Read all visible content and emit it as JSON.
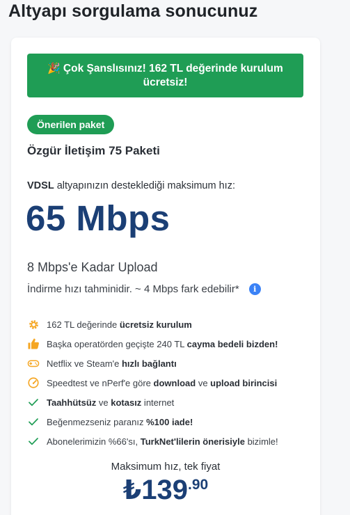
{
  "page": {
    "title": "Altyapı sorgulama sonucunuz"
  },
  "promo": {
    "icon": "party-popper-icon",
    "text": "Çok Şanslısınız! 162 TL değerinde kurulum ücretsiz!",
    "bg_color": "#1f9d55"
  },
  "package": {
    "badge": "Önerilen paket",
    "name": "Özgür İletişim 75 Paketi",
    "infra_type": "VDSL",
    "infra_text": " altyapınızın desteklediği maksimum hız:",
    "speed": "65 Mbps",
    "upload": "8 Mbps'e Kadar Upload",
    "estimate_note": "İndirme hızı tahminidir. ~ 4 Mbps fark edebilir*"
  },
  "features": [
    {
      "icon": "gear-icon",
      "parts": [
        [
          "162 TL değerinde ",
          false
        ],
        [
          "ücretsiz kurulum",
          true
        ]
      ]
    },
    {
      "icon": "thumbs-up-icon",
      "parts": [
        [
          "Başka operatörden geçişte 240 TL ",
          false
        ],
        [
          "cayma bedeli bizden!",
          true
        ]
      ]
    },
    {
      "icon": "gamepad-icon",
      "parts": [
        [
          "Netflix ve Steam'e ",
          false
        ],
        [
          "hızlı bağlantı",
          true
        ]
      ]
    },
    {
      "icon": "speedometer-icon",
      "parts": [
        [
          "Speedtest ve nPerf'e göre ",
          false
        ],
        [
          "download",
          true
        ],
        [
          " ve ",
          false
        ],
        [
          "upload birincisi",
          true
        ]
      ]
    },
    {
      "icon": "check-icon",
      "parts": [
        [
          "Taahhütsüz",
          true
        ],
        [
          " ve ",
          false
        ],
        [
          "kotasız",
          true
        ],
        [
          " internet",
          false
        ]
      ]
    },
    {
      "icon": "check-icon",
      "parts": [
        [
          "Beğenmezseniz paranız ",
          false
        ],
        [
          "%100 iade!",
          true
        ]
      ]
    },
    {
      "icon": "check-icon",
      "parts": [
        [
          "Abonelerimizin %66'sı, ",
          false
        ],
        [
          "TurkNet'lilerin önerisiyle",
          true
        ],
        [
          " bizimle!",
          false
        ]
      ]
    }
  ],
  "pricing": {
    "caption": "Maksimum hız, tek fiyat",
    "currency": "₺",
    "amount": "139",
    "decimal": ".90"
  },
  "colors": {
    "accent_green": "#1f9d55",
    "icon_orange": "#f5a623",
    "price_blue": "#1b3f75",
    "info_blue": "#3b82f6"
  }
}
